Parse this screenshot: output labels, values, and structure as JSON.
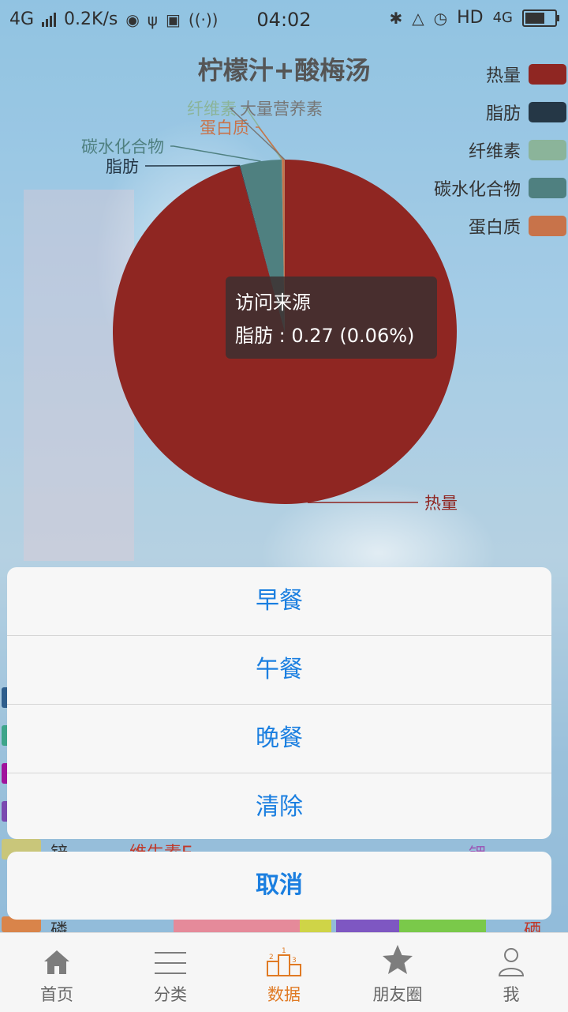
{
  "status_bar": {
    "network": "4G",
    "speed": "0.2K/s",
    "time": "04:02",
    "hd": "HD",
    "network_right": "4G"
  },
  "chart_data": {
    "type": "pie",
    "title": "柠檬汁+酸梅汤",
    "series_name": "访问来源",
    "slices": [
      {
        "name": "热量",
        "value": 444.1,
        "color": "#8f2622"
      },
      {
        "name": "脂肪",
        "value": 0.27,
        "color": "#253746"
      },
      {
        "name": "碳水化合物",
        "value": 18,
        "color": "#4f8080"
      },
      {
        "name": "纤维素",
        "value": 0.1,
        "color": "#8bb49a"
      },
      {
        "name": "蛋白质",
        "value": 1.2,
        "color": "#c8734a"
      },
      {
        "name": "大量营养素",
        "value": 0.05,
        "color": "#777777"
      }
    ],
    "legend": [
      "热量",
      "脂肪",
      "纤维素",
      "碳水化合物",
      "蛋白质"
    ],
    "legend_colors": {
      "热量": "#8f2622",
      "脂肪": "#253746",
      "纤维素": "#8bb49a",
      "碳水化合物": "#4f8080",
      "蛋白质": "#c8734a"
    },
    "legend_position": "top-right",
    "tooltip": {
      "title": "访问来源",
      "text": "脂肪 : 0.27 (0.06%)"
    }
  },
  "background_fragments": {
    "zinc": "锌",
    "vitamin_e": "维生素E",
    "phosphorus": "磷",
    "selenium": "硒",
    "potassium": "钾"
  },
  "action_sheet": {
    "items": [
      "早餐",
      "午餐",
      "晚餐",
      "清除"
    ],
    "cancel": "取消"
  },
  "nav": {
    "items": [
      {
        "label": "首页",
        "icon": "home-icon"
      },
      {
        "label": "分类",
        "icon": "menu-icon"
      },
      {
        "label": "数据",
        "icon": "podium-icon",
        "active": true
      },
      {
        "label": "朋友圈",
        "icon": "star-icon"
      },
      {
        "label": "我",
        "icon": "person-icon"
      }
    ],
    "active_color": "#e07a24"
  }
}
